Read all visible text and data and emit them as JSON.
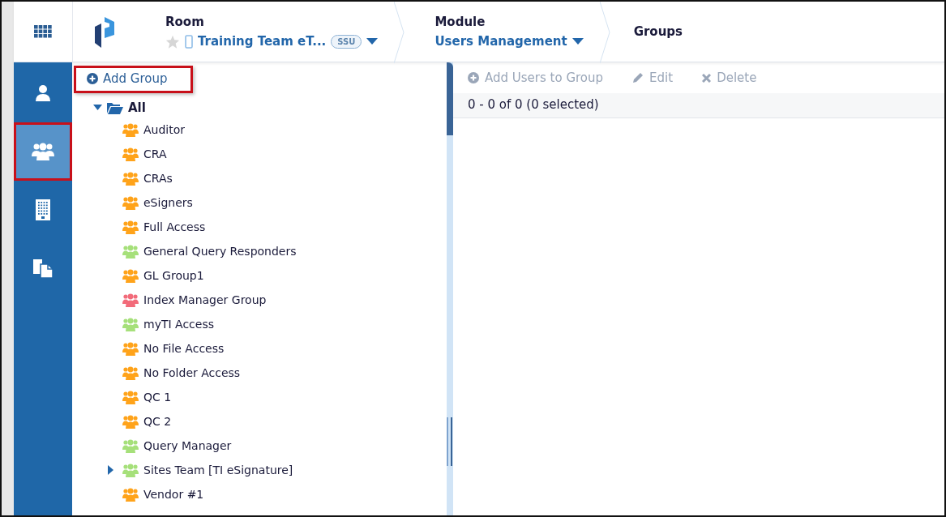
{
  "header": {
    "breadcrumbs": [
      {
        "kind": "room",
        "label": "Room",
        "value": "Training Team eT...",
        "badge": "SSU",
        "starred": false
      },
      {
        "kind": "module",
        "label": "Module",
        "value": "Users Management"
      },
      {
        "kind": "page",
        "label": "Groups"
      }
    ]
  },
  "sidebar": {
    "items": [
      {
        "kind": "user",
        "selected": false,
        "highlighted": false
      },
      {
        "kind": "users",
        "selected": true,
        "highlighted": true
      },
      {
        "kind": "building",
        "selected": false,
        "highlighted": false
      },
      {
        "kind": "documents",
        "selected": false,
        "highlighted": false
      }
    ]
  },
  "tree_panel": {
    "add_button": {
      "label": "Add Group",
      "highlighted": true
    },
    "tree": {
      "label": "All",
      "expanded": true,
      "children": [
        {
          "label": "Auditor",
          "color": "#ffa31a",
          "expandable": false
        },
        {
          "label": "CRA",
          "color": "#ffa31a",
          "expandable": false
        },
        {
          "label": "CRAs",
          "color": "#ffa31a",
          "expandable": false
        },
        {
          "label": "eSigners",
          "color": "#ffa31a",
          "expandable": false
        },
        {
          "label": "Full Access",
          "color": "#ffa31a",
          "expandable": false
        },
        {
          "label": "General Query Responders",
          "color": "#a6e07a",
          "expandable": false
        },
        {
          "label": "GL Group1",
          "color": "#ffa31a",
          "expandable": false
        },
        {
          "label": "Index Manager Group",
          "color": "#f26b7a",
          "expandable": false
        },
        {
          "label": "myTI Access",
          "color": "#a6e07a",
          "expandable": false
        },
        {
          "label": "No File Access",
          "color": "#ffa31a",
          "expandable": false
        },
        {
          "label": "No Folder Access",
          "color": "#ffa31a",
          "expandable": false
        },
        {
          "label": "QC 1",
          "color": "#ffa31a",
          "expandable": false
        },
        {
          "label": "QC 2",
          "color": "#ffa31a",
          "expandable": false
        },
        {
          "label": "Query Manager",
          "color": "#a6e07a",
          "expandable": false
        },
        {
          "label": "Sites Team [TI eSignature]",
          "color": "#a6e07a",
          "expandable": true
        },
        {
          "label": "Vendor #1",
          "color": "#ffa31a",
          "expandable": false
        }
      ]
    }
  },
  "content": {
    "toolbar": [
      {
        "label": "Add Users to Group",
        "disabled": true
      },
      {
        "label": "Edit",
        "disabled": true
      },
      {
        "label": "Delete",
        "disabled": true
      }
    ],
    "status": "0 - 0 of 0 (0 selected)"
  }
}
